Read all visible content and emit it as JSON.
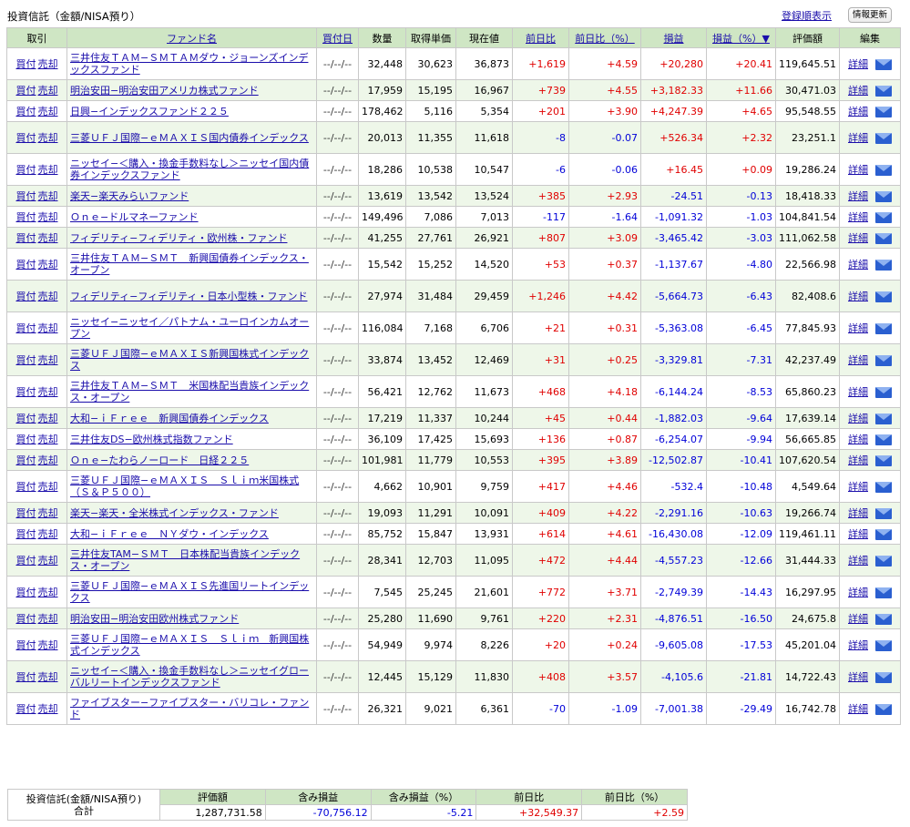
{
  "page": {
    "title": "投資信託（金額/NISA預り）",
    "sort_link": "登録順表示",
    "refresh_button": "情報更新"
  },
  "headers": [
    "取引",
    "ファンド名",
    "買付日",
    "数量",
    "取得単価",
    "現在値",
    "前日比",
    "前日比（%）",
    "損益",
    "損益（%）▼",
    "評価額",
    "編集"
  ],
  "labels": {
    "buy": "買付",
    "sell": "売却",
    "detail": "詳細"
  },
  "rows": [
    {
      "name": "三井住友ＴＡＭ−ＳＭＴＡＭダウ・ジョーンズインデックスファンド",
      "date": "--/--/--",
      "qty": "32,448",
      "cost": "30,623",
      "price": "36,873",
      "chg": "+1,619",
      "chg_pct": "+4.59",
      "pl": "+20,280",
      "pl_pct": "+20.41",
      "value": "119,645.51"
    },
    {
      "name": "明治安田−明治安田アメリカ株式ファンド",
      "date": "--/--/--",
      "qty": "17,959",
      "cost": "15,195",
      "price": "16,967",
      "chg": "+739",
      "chg_pct": "+4.55",
      "pl": "+3,182.33",
      "pl_pct": "+11.66",
      "value": "30,471.03"
    },
    {
      "name": "日興−インデックスファンド２２５",
      "date": "--/--/--",
      "qty": "178,462",
      "cost": "5,116",
      "price": "5,354",
      "chg": "+201",
      "chg_pct": "+3.90",
      "pl": "+4,247.39",
      "pl_pct": "+4.65",
      "value": "95,548.55"
    },
    {
      "name": "三菱ＵＦＪ国際−ｅＭＡＸＩＳ国内債券インデックス",
      "date": "--/--/--",
      "qty": "20,013",
      "cost": "11,355",
      "price": "11,618",
      "chg": "-8",
      "chg_pct": "-0.07",
      "pl": "+526.34",
      "pl_pct": "+2.32",
      "value": "23,251.1"
    },
    {
      "name": "ニッセイ−＜購入・換金手数料なし＞ニッセイ国内債券インデックスファンド",
      "date": "--/--/--",
      "qty": "18,286",
      "cost": "10,538",
      "price": "10,547",
      "chg": "-6",
      "chg_pct": "-0.06",
      "pl": "+16.45",
      "pl_pct": "+0.09",
      "value": "19,286.24"
    },
    {
      "name": "楽天−楽天みらいファンド",
      "date": "--/--/--",
      "qty": "13,619",
      "cost": "13,542",
      "price": "13,524",
      "chg": "+385",
      "chg_pct": "+2.93",
      "pl": "-24.51",
      "pl_pct": "-0.13",
      "value": "18,418.33"
    },
    {
      "name": "Ｏｎｅ−ドルマネーファンド",
      "date": "--/--/--",
      "qty": "149,496",
      "cost": "7,086",
      "price": "7,013",
      "chg": "-117",
      "chg_pct": "-1.64",
      "pl": "-1,091.32",
      "pl_pct": "-1.03",
      "value": "104,841.54"
    },
    {
      "name": "フィデリティ−フィデリティ・欧州株・ファンド",
      "date": "--/--/--",
      "qty": "41,255",
      "cost": "27,761",
      "price": "26,921",
      "chg": "+807",
      "chg_pct": "+3.09",
      "pl": "-3,465.42",
      "pl_pct": "-3.03",
      "value": "111,062.58"
    },
    {
      "name": "三井住友ＴＡＭ−ＳＭＴ　新興国債券インデックス・オープン",
      "date": "--/--/--",
      "qty": "15,542",
      "cost": "15,252",
      "price": "14,520",
      "chg": "+53",
      "chg_pct": "+0.37",
      "pl": "-1,137.67",
      "pl_pct": "-4.80",
      "value": "22,566.98"
    },
    {
      "name": "フィデリティ−フィデリティ・日本小型株・ファンド",
      "date": "--/--/--",
      "qty": "27,974",
      "cost": "31,484",
      "price": "29,459",
      "chg": "+1,246",
      "chg_pct": "+4.42",
      "pl": "-5,664.73",
      "pl_pct": "-6.43",
      "value": "82,408.6"
    },
    {
      "name": "ニッセイ−ニッセイ／パトナム・ユーロインカムオープン",
      "date": "--/--/--",
      "qty": "116,084",
      "cost": "7,168",
      "price": "6,706",
      "chg": "+21",
      "chg_pct": "+0.31",
      "pl": "-5,363.08",
      "pl_pct": "-6.45",
      "value": "77,845.93"
    },
    {
      "name": "三菱ＵＦＪ国際−ｅＭＡＸＩＳ新興国株式インデックス",
      "date": "--/--/--",
      "qty": "33,874",
      "cost": "13,452",
      "price": "12,469",
      "chg": "+31",
      "chg_pct": "+0.25",
      "pl": "-3,329.81",
      "pl_pct": "-7.31",
      "value": "42,237.49"
    },
    {
      "name": "三井住友ＴＡＭ−ＳＭＴ　米国株配当貴族インデックス・オープン",
      "date": "--/--/--",
      "qty": "56,421",
      "cost": "12,762",
      "price": "11,673",
      "chg": "+468",
      "chg_pct": "+4.18",
      "pl": "-6,144.24",
      "pl_pct": "-8.53",
      "value": "65,860.23"
    },
    {
      "name": "大和−ｉＦｒｅｅ　新興国債券インデックス",
      "date": "--/--/--",
      "qty": "17,219",
      "cost": "11,337",
      "price": "10,244",
      "chg": "+45",
      "chg_pct": "+0.44",
      "pl": "-1,882.03",
      "pl_pct": "-9.64",
      "value": "17,639.14"
    },
    {
      "name": "三井住友DS−欧州株式指数ファンド",
      "date": "--/--/--",
      "qty": "36,109",
      "cost": "17,425",
      "price": "15,693",
      "chg": "+136",
      "chg_pct": "+0.87",
      "pl": "-6,254.07",
      "pl_pct": "-9.94",
      "value": "56,665.85"
    },
    {
      "name": "Ｏｎｅ−たわらノーロード　日経２２５",
      "date": "--/--/--",
      "qty": "101,981",
      "cost": "11,779",
      "price": "10,553",
      "chg": "+395",
      "chg_pct": "+3.89",
      "pl": "-12,502.87",
      "pl_pct": "-10.41",
      "value": "107,620.54"
    },
    {
      "name": "三菱ＵＦＪ国際−ｅＭＡＸＩＳ　Ｓｌｉｍ米国株式（Ｓ＆Ｐ５００）",
      "date": "--/--/--",
      "qty": "4,662",
      "cost": "10,901",
      "price": "9,759",
      "chg": "+417",
      "chg_pct": "+4.46",
      "pl": "-532.4",
      "pl_pct": "-10.48",
      "value": "4,549.64"
    },
    {
      "name": "楽天−楽天・全米株式インデックス・ファンド",
      "date": "--/--/--",
      "qty": "19,093",
      "cost": "11,291",
      "price": "10,091",
      "chg": "+409",
      "chg_pct": "+4.22",
      "pl": "-2,291.16",
      "pl_pct": "-10.63",
      "value": "19,266.74"
    },
    {
      "name": "大和−ｉＦｒｅｅ　ＮＹダウ・インデックス",
      "date": "--/--/--",
      "qty": "85,752",
      "cost": "15,847",
      "price": "13,931",
      "chg": "+614",
      "chg_pct": "+4.61",
      "pl": "-16,430.08",
      "pl_pct": "-12.09",
      "value": "119,461.11"
    },
    {
      "name": "三井住友TAM−ＳＭＴ　日本株配当貴族インデックス・オープン",
      "date": "--/--/--",
      "qty": "28,341",
      "cost": "12,703",
      "price": "11,095",
      "chg": "+472",
      "chg_pct": "+4.44",
      "pl": "-4,557.23",
      "pl_pct": "-12.66",
      "value": "31,444.33"
    },
    {
      "name": "三菱ＵＦＪ国際−ｅＭＡＸＩＳ先進国リートインデックス",
      "date": "--/--/--",
      "qty": "7,545",
      "cost": "25,245",
      "price": "21,601",
      "chg": "+772",
      "chg_pct": "+3.71",
      "pl": "-2,749.39",
      "pl_pct": "-14.43",
      "value": "16,297.95"
    },
    {
      "name": "明治安田−明治安田欧州株式ファンド",
      "date": "--/--/--",
      "qty": "25,280",
      "cost": "11,690",
      "price": "9,761",
      "chg": "+220",
      "chg_pct": "+2.31",
      "pl": "-4,876.51",
      "pl_pct": "-16.50",
      "value": "24,675.8"
    },
    {
      "name": "三菱ＵＦＪ国際−ｅＭＡＸＩＳ　Ｓｌｉｍ　新興国株式インデックス",
      "date": "--/--/--",
      "qty": "54,949",
      "cost": "9,974",
      "price": "8,226",
      "chg": "+20",
      "chg_pct": "+0.24",
      "pl": "-9,605.08",
      "pl_pct": "-17.53",
      "value": "45,201.04"
    },
    {
      "name": "ニッセイ−＜購入・換金手数料なし＞ニッセイグローバルリートインデックスファンド",
      "date": "--/--/--",
      "qty": "12,445",
      "cost": "15,129",
      "price": "11,830",
      "chg": "+408",
      "chg_pct": "+3.57",
      "pl": "-4,105.6",
      "pl_pct": "-21.81",
      "value": "14,722.43"
    },
    {
      "name": "ファイブスター−ファイブスター・バリコレ・ファンド",
      "date": "--/--/--",
      "qty": "26,321",
      "cost": "9,021",
      "price": "6,361",
      "chg": "-70",
      "chg_pct": "-1.09",
      "pl": "-7,001.38",
      "pl_pct": "-29.49",
      "value": "16,742.78"
    }
  ],
  "summary": {
    "label_line1": "投資信託(金額/NISA預り)",
    "label_line2": "合計",
    "headers": [
      "評価額",
      "含み損益",
      "含み損益（%）",
      "前日比",
      "前日比（%）"
    ],
    "values": [
      "1,287,731.58",
      "-70,756.12",
      "-5.21",
      "+32,549.37",
      "+2.59"
    ]
  },
  "colors": {
    "positive": "#e00000",
    "negative": "#0000d8",
    "header_bg": "#cfe6c4",
    "row_alt_bg": "#eef7e9",
    "link": "#1a0dab"
  }
}
